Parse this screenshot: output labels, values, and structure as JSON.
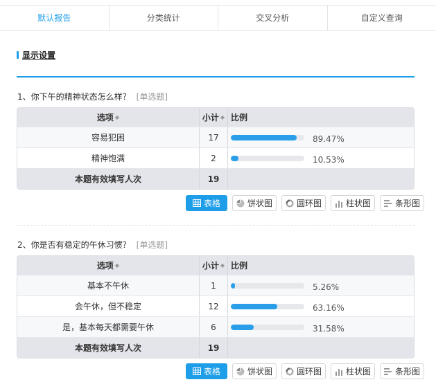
{
  "tabs": [
    "默认报告",
    "分类统计",
    "交叉分析",
    "自定义查询"
  ],
  "settings_label": "显示设置",
  "header": {
    "option": "选项",
    "count": "小计",
    "ratio": "比例"
  },
  "colors": {
    "accent": "#1e9ee8",
    "bar": "#2a9ee8"
  },
  "chart_buttons": [
    "表格",
    "饼状图",
    "圆环图",
    "柱状图",
    "条形图"
  ],
  "questions": [
    {
      "title": "1、你下午的精神状态怎么样？",
      "type": "[单选题]",
      "rows": [
        {
          "label": "容易犯困",
          "count": "17",
          "pct": "89.47%",
          "fraction": 0.8947
        },
        {
          "label": "精神饱满",
          "count": "2",
          "pct": "10.53%",
          "fraction": 0.1053
        }
      ],
      "total_label": "本题有效填写人次",
      "total": "19"
    },
    {
      "title": "2、你是否有稳定的午休习惯？",
      "type": "[单选题]",
      "rows": [
        {
          "label": "基本不午休",
          "count": "1",
          "pct": "5.26%",
          "fraction": 0.0526
        },
        {
          "label": "会午休，但不稳定",
          "count": "12",
          "pct": "63.16%",
          "fraction": 0.6316
        },
        {
          "label": "是，基本每天都需要午休",
          "count": "6",
          "pct": "31.58%",
          "fraction": 0.3158
        }
      ],
      "total_label": "本题有效填写人次",
      "total": "19"
    }
  ]
}
